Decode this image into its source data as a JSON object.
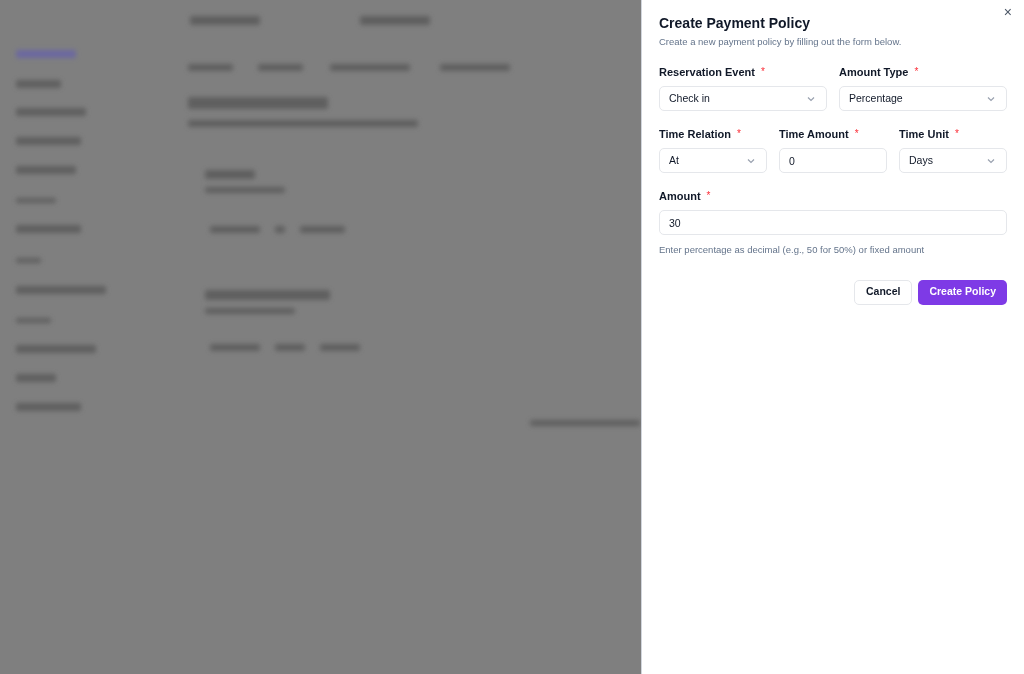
{
  "dialog": {
    "title": "Create Payment Policy",
    "close": "×",
    "description": "Create a new payment policy by filling out the form below.",
    "rows": [
      [
        {
          "kind": "select",
          "label": "Reservation Event",
          "required_mark": "*",
          "value": "Check in"
        },
        {
          "kind": "select",
          "label": "Amount Type",
          "required_mark": "*",
          "value": "Percentage"
        }
      ],
      [
        {
          "kind": "select",
          "label": "Time Relation",
          "required_mark": "*",
          "value": "At"
        },
        {
          "kind": "input",
          "label": "Time Amount",
          "required_mark": "*",
          "value": "0"
        },
        {
          "kind": "select",
          "label": "Time Unit",
          "required_mark": "*",
          "value": "Days"
        }
      ],
      [
        {
          "kind": "input",
          "label": "Amount",
          "required_mark": "*",
          "value": "30",
          "hint": "Enter percentage as decimal (e.g., 50 for 50%) or fixed amount"
        }
      ]
    ],
    "buttons": [
      {
        "kind": "secondary",
        "label": "Cancel"
      },
      {
        "kind": "primary",
        "label": "Create Policy"
      }
    ]
  }
}
